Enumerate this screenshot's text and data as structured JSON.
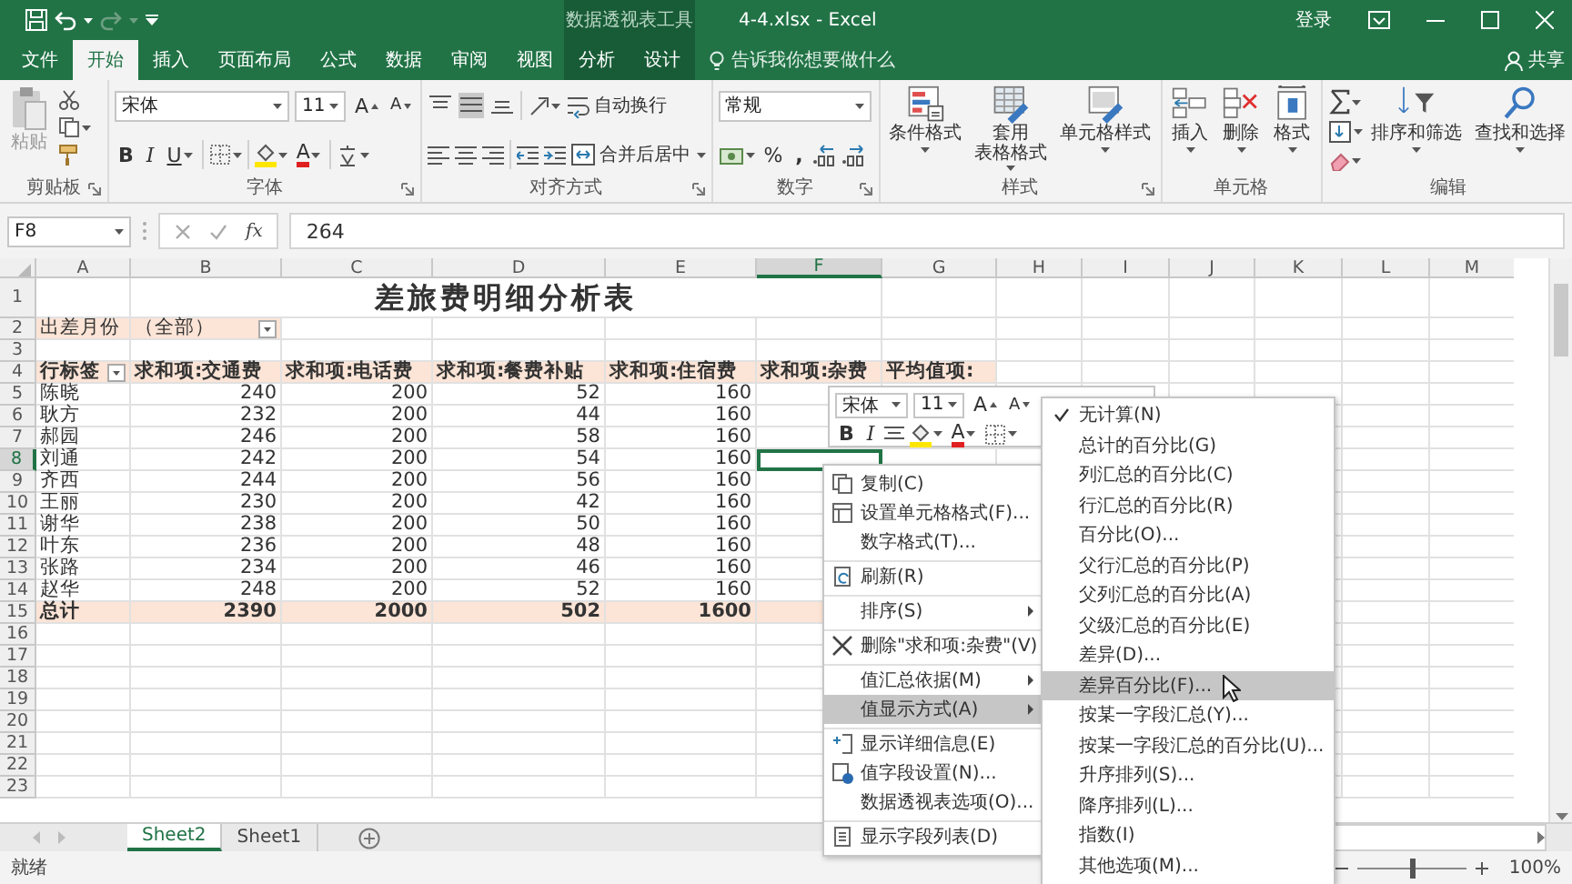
{
  "title_bar": {
    "context_label": "数据透视表工具",
    "title": "4-4.xlsx - Excel",
    "sign_in": "登录"
  },
  "ribbon_tabs": [
    {
      "label": "文件",
      "selected": false,
      "kind": "main"
    },
    {
      "label": "开始",
      "selected": true,
      "kind": "main"
    },
    {
      "label": "插入",
      "selected": false,
      "kind": "main"
    },
    {
      "label": "页面布局",
      "selected": false,
      "kind": "main"
    },
    {
      "label": "公式",
      "selected": false,
      "kind": "main"
    },
    {
      "label": "数据",
      "selected": false,
      "kind": "main"
    },
    {
      "label": "审阅",
      "selected": false,
      "kind": "main"
    },
    {
      "label": "视图",
      "selected": false,
      "kind": "main"
    },
    {
      "label": "分析",
      "selected": false,
      "kind": "context"
    },
    {
      "label": "设计",
      "selected": false,
      "kind": "context"
    }
  ],
  "tell_me": "告诉我你想要做什么",
  "share": "共享",
  "ribbon": {
    "clipboard": {
      "paste": "粘贴",
      "paste_disabled": true,
      "label": "剪贴板"
    },
    "font": {
      "name": "宋体",
      "size": "11",
      "grow": "A",
      "shrink": "A",
      "bold": "B",
      "italic": "I",
      "underline": "U",
      "font_color": "A",
      "label": "字体"
    },
    "alignment": {
      "vertical_align": [
        {
          "selected": false
        },
        {
          "selected": true
        },
        {
          "selected": false
        }
      ],
      "wrap": "自动换行",
      "merge": "合并后居中",
      "label": "对齐方式"
    },
    "number": {
      "format": "常规",
      "percent": "%",
      "comma": ",",
      "label": "数字"
    },
    "styles": {
      "conditional": "条件格式",
      "table_format": [
        "套用",
        "表格格式"
      ],
      "cell_styles": "单元格样式",
      "label": "样式"
    },
    "cells": {
      "insert": "插入",
      "delete": "删除",
      "format": "格式",
      "label": "单元格"
    },
    "editing": {
      "sort": "排序和筛选",
      "find": "查找和选择",
      "label": "编辑"
    }
  },
  "formula_bar": {
    "name_box": "F8",
    "function_label": "fx",
    "formula": "264"
  },
  "sheet": {
    "columns": [
      {
        "label": "A",
        "selected": false
      },
      {
        "label": "B",
        "selected": false
      },
      {
        "label": "C",
        "selected": false
      },
      {
        "label": "D",
        "selected": false
      },
      {
        "label": "E",
        "selected": false
      },
      {
        "label": "F",
        "selected": true
      },
      {
        "label": "G",
        "selected": false
      },
      {
        "label": "H",
        "selected": false
      },
      {
        "label": "I",
        "selected": false
      },
      {
        "label": "J",
        "selected": false
      },
      {
        "label": "K",
        "selected": false
      },
      {
        "label": "L",
        "selected": false
      },
      {
        "label": "M",
        "selected": false
      }
    ],
    "rows": [
      {
        "number": "1",
        "selected": false,
        "kind": "title",
        "title": "差旅费明细分析表"
      },
      {
        "number": "2",
        "selected": false,
        "kind": "filter",
        "cells": [
          "出差月份",
          "（全部）"
        ]
      },
      {
        "number": "3",
        "selected": false,
        "kind": "blank",
        "cells": []
      },
      {
        "number": "4",
        "selected": false,
        "kind": "header",
        "cells": [
          "行标签",
          "求和项:交通费",
          "求和项:电话费",
          "求和项:餐费补贴",
          "求和项:住宿费",
          "求和项:杂费",
          "平均值项:"
        ]
      },
      {
        "number": "5",
        "selected": false,
        "kind": "data",
        "cells": [
          "陈晓",
          "240",
          "200",
          "52",
          "160"
        ]
      },
      {
        "number": "6",
        "selected": false,
        "kind": "data",
        "cells": [
          "耿方",
          "232",
          "200",
          "44",
          "160"
        ]
      },
      {
        "number": "7",
        "selected": false,
        "kind": "data",
        "cells": [
          "郝园",
          "246",
          "200",
          "58",
          "160"
        ]
      },
      {
        "number": "8",
        "selected": true,
        "kind": "data",
        "cells": [
          "刘通",
          "242",
          "200",
          "54",
          "160"
        ]
      },
      {
        "number": "9",
        "selected": false,
        "kind": "data",
        "cells": [
          "齐西",
          "244",
          "200",
          "56",
          "160"
        ]
      },
      {
        "number": "10",
        "selected": false,
        "kind": "data",
        "cells": [
          "王丽",
          "230",
          "200",
          "42",
          "160"
        ]
      },
      {
        "number": "11",
        "selected": false,
        "kind": "data",
        "cells": [
          "谢华",
          "238",
          "200",
          "50",
          "160"
        ]
      },
      {
        "number": "12",
        "selected": false,
        "kind": "data",
        "cells": [
          "叶东",
          "236",
          "200",
          "48",
          "160"
        ]
      },
      {
        "number": "13",
        "selected": false,
        "kind": "data",
        "cells": [
          "张路",
          "234",
          "200",
          "46",
          "160"
        ]
      },
      {
        "number": "14",
        "selected": false,
        "kind": "data",
        "cells": [
          "赵华",
          "248",
          "200",
          "52",
          "160"
        ]
      },
      {
        "number": "15",
        "selected": false,
        "kind": "total",
        "cells": [
          "总计",
          "2390",
          "2000",
          "502",
          "1600"
        ]
      },
      {
        "number": "16",
        "selected": false,
        "kind": "blank",
        "cells": []
      },
      {
        "number": "17",
        "selected": false,
        "kind": "blank",
        "cells": []
      },
      {
        "number": "18",
        "selected": false,
        "kind": "blank",
        "cells": []
      },
      {
        "number": "19",
        "selected": false,
        "kind": "blank",
        "cells": []
      },
      {
        "number": "20",
        "selected": false,
        "kind": "blank",
        "cells": []
      },
      {
        "number": "21",
        "selected": false,
        "kind": "blank",
        "cells": []
      },
      {
        "number": "22",
        "selected": false,
        "kind": "blank",
        "cells": []
      },
      {
        "number": "23",
        "selected": false,
        "kind": "blank",
        "cells": []
      }
    ]
  },
  "mini_toolbar": {
    "font": "宋体",
    "size": "11",
    "grow": "A",
    "shrink": "A",
    "bold": "B",
    "italic": "I",
    "font_color": "A"
  },
  "context_menu": {
    "items": [
      {
        "label": "复制(C)",
        "kind": "copy",
        "has_submenu": false,
        "selected": false,
        "separator_before": false
      },
      {
        "label": "设置单元格格式(F)...",
        "kind": "format-cells",
        "has_submenu": false,
        "selected": false,
        "separator_before": false
      },
      {
        "label": "数字格式(T)...",
        "kind": "plain",
        "has_submenu": false,
        "selected": false,
        "separator_before": false
      },
      {
        "label": "刷新(R)",
        "kind": "refresh",
        "has_submenu": false,
        "selected": false,
        "separator_before": true
      },
      {
        "label": "排序(S)",
        "kind": "plain",
        "has_submenu": true,
        "selected": false,
        "separator_before": true
      },
      {
        "label": "删除\"求和项:杂费\"(V)",
        "kind": "delete",
        "has_submenu": false,
        "selected": false,
        "separator_before": true
      },
      {
        "label": "值汇总依据(M)",
        "kind": "plain",
        "has_submenu": true,
        "selected": false,
        "separator_before": true
      },
      {
        "label": "值显示方式(A)",
        "kind": "plain",
        "has_submenu": true,
        "selected": true,
        "separator_before": false
      },
      {
        "label": "显示详细信息(E)",
        "kind": "show-details",
        "has_submenu": false,
        "selected": false,
        "separator_before": true
      },
      {
        "label": "值字段设置(N)...",
        "kind": "field-settings",
        "has_submenu": false,
        "selected": false,
        "separator_before": false
      },
      {
        "label": "数据透视表选项(O)...",
        "kind": "plain",
        "has_submenu": false,
        "selected": false,
        "separator_before": false
      },
      {
        "label": "显示字段列表(D)",
        "kind": "field-list",
        "has_submenu": false,
        "selected": false,
        "separator_before": true
      }
    ]
  },
  "value_menu": {
    "items": [
      {
        "label": "无计算(N)",
        "checked": true,
        "selected": false
      },
      {
        "label": "总计的百分比(G)",
        "checked": false,
        "selected": false
      },
      {
        "label": "列汇总的百分比(C)",
        "checked": false,
        "selected": false
      },
      {
        "label": "行汇总的百分比(R)",
        "checked": false,
        "selected": false
      },
      {
        "label": "百分比(O)...",
        "checked": false,
        "selected": false
      },
      {
        "label": "父行汇总的百分比(P)",
        "checked": false,
        "selected": false
      },
      {
        "label": "父列汇总的百分比(A)",
        "checked": false,
        "selected": false
      },
      {
        "label": "父级汇总的百分比(E)",
        "checked": false,
        "selected": false
      },
      {
        "label": "差异(D)...",
        "checked": false,
        "selected": false
      },
      {
        "label": "差异百分比(F)...",
        "checked": false,
        "selected": true
      },
      {
        "label": "按某一字段汇总(Y)...",
        "checked": false,
        "selected": false
      },
      {
        "label": "按某一字段汇总的百分比(U)...",
        "checked": false,
        "selected": false
      },
      {
        "label": "升序排列(S)...",
        "checked": false,
        "selected": false
      },
      {
        "label": "降序排列(L)...",
        "checked": false,
        "selected": false
      },
      {
        "label": "指数(I)",
        "checked": false,
        "selected": false
      },
      {
        "label": "其他选项(M)...",
        "checked": false,
        "selected": false
      }
    ]
  },
  "sheet_tabs": [
    {
      "label": "Sheet2",
      "selected": true
    },
    {
      "label": "Sheet1",
      "selected": false
    }
  ],
  "status_bar": {
    "text": "就绪",
    "zoom": "100%",
    "zoom_slider": {
      "level": 0.5
    }
  }
}
